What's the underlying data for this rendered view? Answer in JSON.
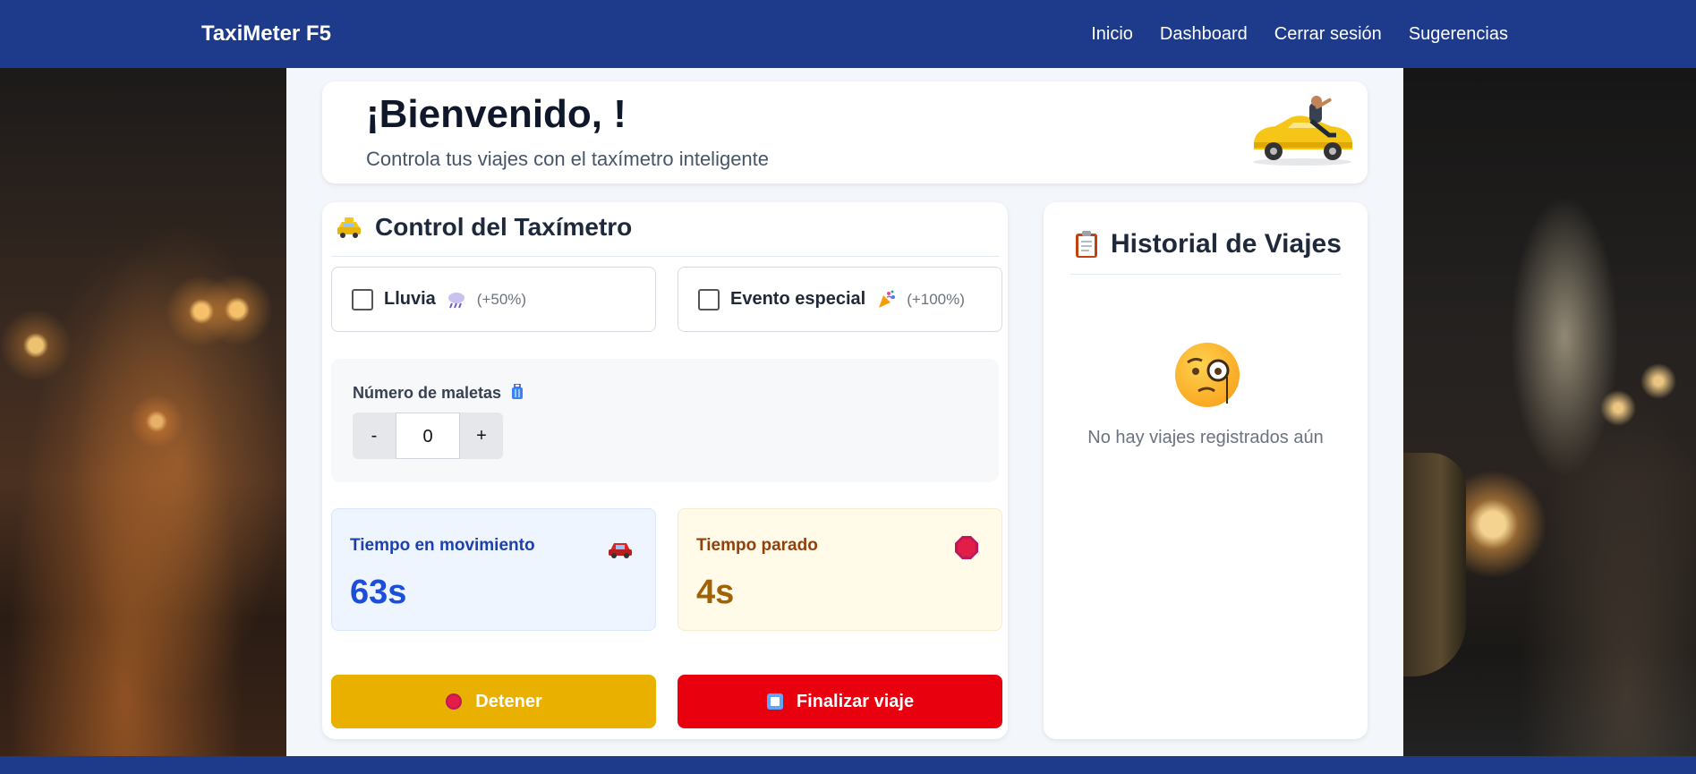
{
  "navbar": {
    "brand": "TaxiMeter F5",
    "links": [
      "Inicio",
      "Dashboard",
      "Cerrar sesión",
      "Sugerencias"
    ],
    "background": "#1e3a8a"
  },
  "welcome": {
    "title": "¡Bienvenido, !",
    "subtitle": "Controla tus viajes con el taxímetro inteligente"
  },
  "control": {
    "title": "Control del Taxímetro",
    "title_icon": "taxi-icon",
    "options": [
      {
        "label": "Lluvia",
        "icon": "rain-cloud-icon",
        "extra": "(+50%)",
        "checked": false
      },
      {
        "label": "Evento especial",
        "icon": "party-popper-icon",
        "extra": "(+100%)",
        "checked": false
      }
    ],
    "luggage": {
      "label": "Número de maletas",
      "icon": "luggage-icon",
      "minus": "-",
      "value": "0",
      "plus": "+"
    },
    "stats": {
      "moving": {
        "label": "Tiempo en movimiento",
        "value": "63s",
        "icon": "car-icon"
      },
      "stopped": {
        "label": "Tiempo parado",
        "value": "4s",
        "icon": "stop-sign-icon"
      }
    },
    "buttons": {
      "stop": {
        "label": "Detener",
        "icon": "red-circle-icon",
        "color": "#eab000"
      },
      "finish": {
        "label": "Finalizar viaje",
        "icon": "stop-square-icon",
        "color": "#e8000f"
      }
    }
  },
  "history": {
    "title": "Historial de Viajes",
    "title_icon": "clipboard-icon",
    "empty_icon": "monocle-face-icon",
    "empty_text": "No hay viajes registrados aún"
  }
}
